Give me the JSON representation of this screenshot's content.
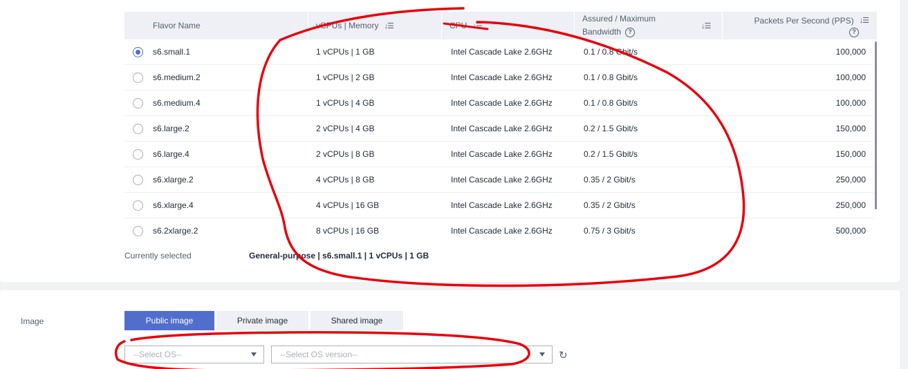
{
  "table": {
    "headers": {
      "flavor_name": "Flavor Name",
      "vcpus_memory": "vCPUs | Memory",
      "cpu": "CPU",
      "bandwidth_line1": "Assured / Maximum",
      "bandwidth_line2": "Bandwidth",
      "pps": "Packets Per Second (PPS)",
      "sort_icon": "sort-icon",
      "help_icon": "question-circle-icon"
    },
    "rows": [
      {
        "name": "s6.small.1",
        "vcpus_memory": "1 vCPUs | 1 GB",
        "cpu": "Intel Cascade Lake 2.6GHz",
        "bandwidth": "0.1 / 0.8 Gbit/s",
        "pps": "100,000",
        "selected": true
      },
      {
        "name": "s6.medium.2",
        "vcpus_memory": "1 vCPUs | 2 GB",
        "cpu": "Intel Cascade Lake 2.6GHz",
        "bandwidth": "0.1 / 0.8 Gbit/s",
        "pps": "100,000",
        "selected": false
      },
      {
        "name": "s6.medium.4",
        "vcpus_memory": "1 vCPUs | 4 GB",
        "cpu": "Intel Cascade Lake 2.6GHz",
        "bandwidth": "0.1 / 0.8 Gbit/s",
        "pps": "100,000",
        "selected": false
      },
      {
        "name": "s6.large.2",
        "vcpus_memory": "2 vCPUs | 4 GB",
        "cpu": "Intel Cascade Lake 2.6GHz",
        "bandwidth": "0.2 / 1.5 Gbit/s",
        "pps": "150,000",
        "selected": false
      },
      {
        "name": "s6.large.4",
        "vcpus_memory": "2 vCPUs | 8 GB",
        "cpu": "Intel Cascade Lake 2.6GHz",
        "bandwidth": "0.2 / 1.5 Gbit/s",
        "pps": "150,000",
        "selected": false
      },
      {
        "name": "s6.xlarge.2",
        "vcpus_memory": "4 vCPUs | 8 GB",
        "cpu": "Intel Cascade Lake 2.6GHz",
        "bandwidth": "0.35 / 2 Gbit/s",
        "pps": "250,000",
        "selected": false
      },
      {
        "name": "s6.xlarge.4",
        "vcpus_memory": "4 vCPUs | 16 GB",
        "cpu": "Intel Cascade Lake 2.6GHz",
        "bandwidth": "0.35 / 2 Gbit/s",
        "pps": "250,000",
        "selected": false
      },
      {
        "name": "s6.2xlarge.2",
        "vcpus_memory": "8 vCPUs | 16 GB",
        "cpu": "Intel Cascade Lake 2.6GHz",
        "bandwidth": "0.75 / 3 Gbit/s",
        "pps": "500,000",
        "selected": false
      }
    ]
  },
  "selection": {
    "label": "Currently selected",
    "value": "General-purpose | s6.small.1 | 1 vCPUs | 1 GB"
  },
  "image": {
    "label": "Image",
    "tabs": [
      {
        "label": "Public image",
        "active": true
      },
      {
        "label": "Private image",
        "active": false
      },
      {
        "label": "Shared image",
        "active": false
      }
    ],
    "os_select_placeholder": "--Select OS--",
    "os_version_placeholder": "--Select OS version--",
    "refresh_icon": "refresh-icon"
  },
  "colors": {
    "accent": "#526ecc",
    "annotation": "#e8000b",
    "header_bg": "#eef0f5"
  }
}
